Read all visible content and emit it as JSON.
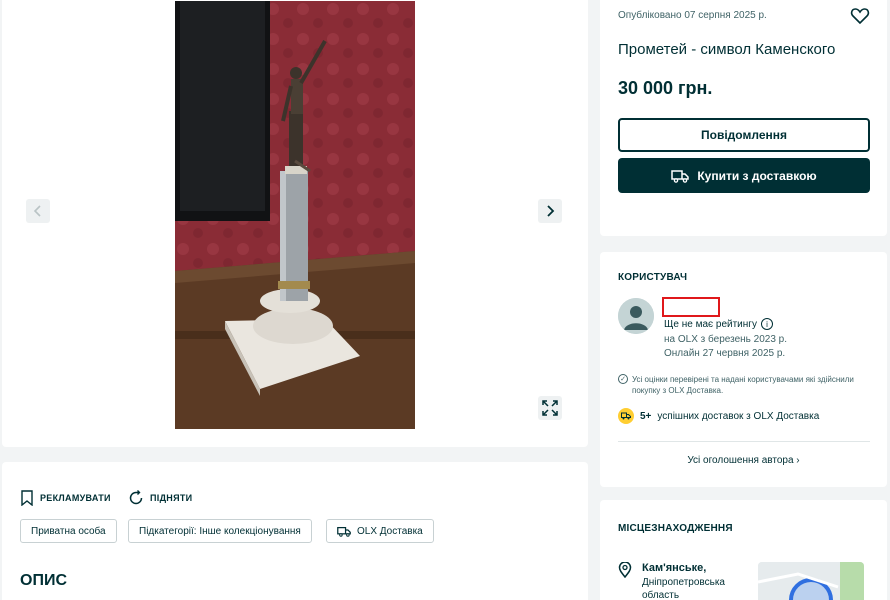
{
  "price_card": {
    "posted": "Опубліковано 07 серпня 2025 р.",
    "title": "Прометей - символ Каменского",
    "price": "30 000 грн.",
    "message_button": "Повідомлення",
    "buy_button": "Купити з доставкою"
  },
  "user_card": {
    "heading": "КОРИСТУВАЧ",
    "rating": "Ще не має рейтингу",
    "since": "на OLX з березень 2023 р.",
    "online": "Онлайн 27 червня 2025 р.",
    "verified_note": "Усі оцінки перевірені та надані користувачами які здійснили покупку з OLX Доставка.",
    "deliveries_count": "5+",
    "deliveries_text": "успішних доставок з OLX Доставка",
    "all_ads": "Усі оголошення автора"
  },
  "location_card": {
    "heading": "МІСЦЕЗНАХОДЖЕННЯ",
    "city": "Кам'янське,",
    "region": "Дніпропетровська область"
  },
  "description_card": {
    "promote": "РЕКЛАМУВАТИ",
    "raise": "ПІДНЯТИ",
    "tags": [
      "Приватна особа",
      "Підкатегорії: Інше колекціонування",
      "OLX Доставка"
    ],
    "heading": "ОПИС"
  },
  "colors": {
    "primary": "#002f34",
    "background": "#f2f4f5",
    "highlight": "#e0181b",
    "badge": "#ffce32"
  }
}
